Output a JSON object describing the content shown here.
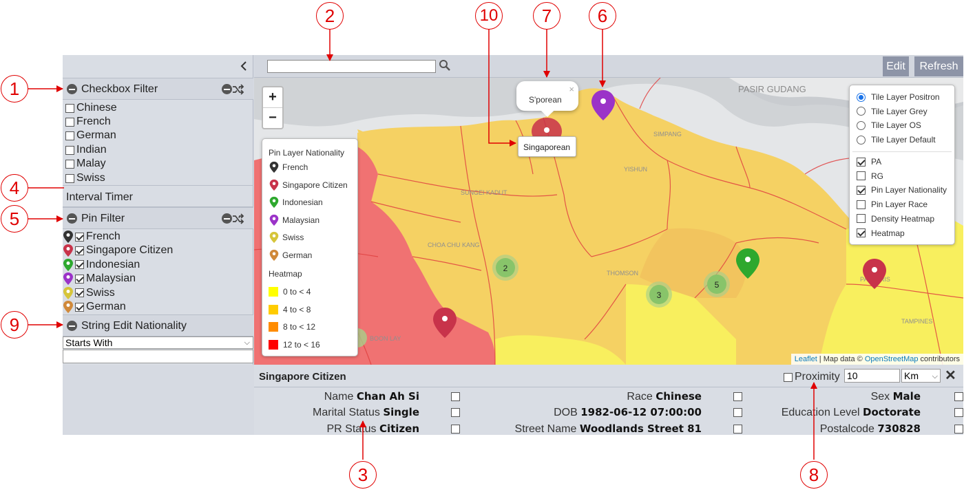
{
  "left_panel": {
    "checkbox_filter": {
      "title": "Checkbox Filter",
      "items": [
        "Chinese",
        "French",
        "German",
        "Indian",
        "Malay",
        "Swiss"
      ]
    },
    "interval_timer": {
      "title": "Interval Timer"
    },
    "pin_filter": {
      "title": "Pin Filter",
      "items": [
        {
          "label": "French",
          "color": "#333333"
        },
        {
          "label": "Singapore Citizen",
          "color": "#c8334a"
        },
        {
          "label": "Indonesian",
          "color": "#2ea82e"
        },
        {
          "label": "Malaysian",
          "color": "#9b33c8"
        },
        {
          "label": "Swiss",
          "color": "#d6c53a"
        },
        {
          "label": "German",
          "color": "#d0893a"
        }
      ]
    },
    "string_edit": {
      "title": "String Edit Nationality",
      "mode": "Starts With"
    }
  },
  "toolbar": {
    "search_value": "",
    "edit_label": "Edit",
    "refresh_label": "Refresh"
  },
  "map": {
    "zoom_in": "+",
    "zoom_out": "−",
    "place_labels": [
      "PASIR GUDANG",
      "SIMPANG",
      "YISHUN",
      "SUNGEI KADUT",
      "CHOA CHU KANG",
      "THOMSON",
      "BOON LAY",
      "TAMPINES",
      "PASIR RIS"
    ],
    "popup_text": "S'porean",
    "popup_close": "×",
    "tooltip_text": "Singaporean",
    "clusters": [
      "2",
      "3",
      "5"
    ],
    "legend": {
      "pin_title": "Pin Layer Nationality",
      "pins": [
        {
          "label": "French",
          "color": "#333333"
        },
        {
          "label": "Singapore Citizen",
          "color": "#c8334a"
        },
        {
          "label": "Indonesian",
          "color": "#2ea82e"
        },
        {
          "label": "Malaysian",
          "color": "#9b33c8"
        },
        {
          "label": "Swiss",
          "color": "#d6c53a"
        },
        {
          "label": "German",
          "color": "#d0893a"
        }
      ],
      "heat_title": "Heatmap",
      "heat": [
        {
          "label": "0 to < 4",
          "color": "#ffff00"
        },
        {
          "label": "4 to < 8",
          "color": "#ffcc00"
        },
        {
          "label": "8 to < 12",
          "color": "#ff8c00"
        },
        {
          "label": "12 to < 16",
          "color": "#ff0000"
        }
      ]
    },
    "layers": {
      "base": [
        {
          "label": "Tile Layer Positron",
          "selected": true
        },
        {
          "label": "Tile Layer Grey",
          "selected": false
        },
        {
          "label": "Tile Layer OS",
          "selected": false
        },
        {
          "label": "Tile Layer Default",
          "selected": false
        }
      ],
      "overlays": [
        {
          "label": "PA",
          "checked": true
        },
        {
          "label": "RG",
          "checked": false
        },
        {
          "label": "Pin Layer Nationality",
          "checked": true
        },
        {
          "label": "Pin Layer Race",
          "checked": false
        },
        {
          "label": "Density Heatmap",
          "checked": false
        },
        {
          "label": "Heatmap",
          "checked": true
        }
      ]
    },
    "attribution": {
      "leaflet": "Leaflet",
      "sep": " | Map data © ",
      "osm": "OpenStreetMap",
      "tail": " contributors"
    }
  },
  "details": {
    "title": "Singapore Citizen",
    "proximity_label": "Proximity",
    "proximity_value": "10",
    "proximity_unit": "Km",
    "close": "✕",
    "fields": [
      {
        "label": "Name",
        "value": "Chan Ah Si"
      },
      {
        "label": "Race",
        "value": "Chinese"
      },
      {
        "label": "Sex",
        "value": "Male"
      },
      {
        "label": "Marital Status",
        "value": "Single"
      },
      {
        "label": "DOB",
        "value": "1982-06-12 07:00:00"
      },
      {
        "label": "Education Level",
        "value": "Doctorate"
      },
      {
        "label": "PR Status",
        "value": "Citizen"
      },
      {
        "label": "Street Name",
        "value": "Woodlands Street 81"
      },
      {
        "label": "Postalcode",
        "value": "730828"
      }
    ]
  },
  "annotations": [
    "1",
    "2",
    "3",
    "4",
    "5",
    "6",
    "7",
    "8",
    "9",
    "10"
  ],
  "colors": {
    "panel": "#d9dde4",
    "button": "#8d94a7",
    "annotation": "#e00000"
  }
}
